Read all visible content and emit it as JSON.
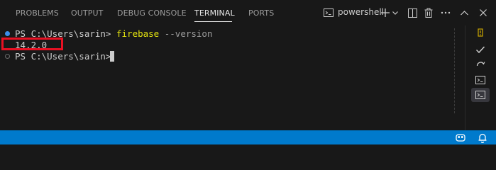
{
  "tabs": [
    {
      "label": "PROBLEMS"
    },
    {
      "label": "OUTPUT"
    },
    {
      "label": "DEBUG CONSOLE"
    },
    {
      "label": "TERMINAL"
    },
    {
      "label": "PORTS"
    }
  ],
  "active_tab": "TERMINAL",
  "toolbar": {
    "shell_name": "powershell",
    "icons": [
      "terminal-icon",
      "plus-icon",
      "chevron-down-icon",
      "split-icon",
      "trash-icon",
      "more-icon",
      "chevron-up-icon",
      "close-icon"
    ]
  },
  "terminal": {
    "lines": [
      {
        "prompt": "PS C:\\Users\\sarin> ",
        "command": "firebase",
        "args": " --version",
        "status": "success"
      },
      {
        "output": "14.2.0"
      },
      {
        "prompt": "PS C:\\Users\\sarin> ",
        "status": "pending"
      }
    ]
  },
  "sidebar": {
    "items": [
      "warning-icon",
      "check-icon",
      "undo-icon",
      "terminal-tab-icon",
      "terminal-tab-icon-active"
    ]
  },
  "statusbar": {
    "icons": [
      "copilot-icon",
      "bell-icon"
    ]
  },
  "colors": {
    "background": "#181818",
    "statusbar": "#007acc",
    "command": "#e5e510",
    "highlight": "#e81123",
    "decoration_ok": "#3b8eea",
    "warning": "#cca700"
  }
}
